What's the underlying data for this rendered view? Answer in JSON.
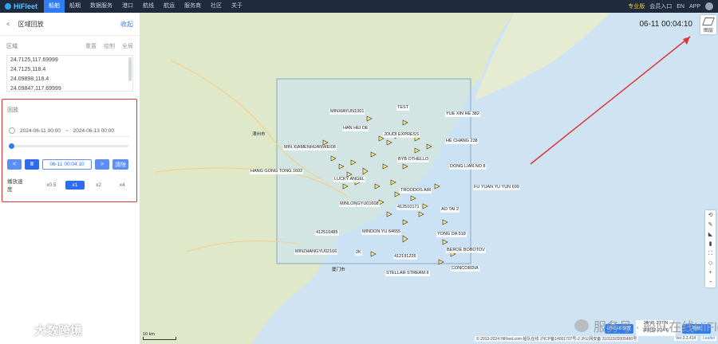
{
  "topbar": {
    "logo": "HiFleet",
    "nav": [
      "船舶",
      "船期",
      "数据服务",
      "港口",
      "航线",
      "航运",
      "服务商",
      "社区",
      "关于"
    ],
    "active_index": 0,
    "right": [
      "专业版",
      "会员入口",
      "EN",
      "APP"
    ]
  },
  "panel": {
    "back": "<",
    "title": "区域回放",
    "collapse": "收起",
    "area_label": "区域",
    "area_actions": [
      "重置",
      "绘制",
      "全局"
    ],
    "coords": [
      "24.7125,117.69999",
      "24.7125,118.4",
      "24.09898,118.4",
      "24.09847,117.69999"
    ],
    "playback": {
      "title": "回放",
      "start": "2024-06-11 00:00",
      "sep": "~",
      "end": "2024-06-13 00:00",
      "btn_prev": "<",
      "btn_pause": "II",
      "time": "06-11 00:04:10",
      "btn_next": ">",
      "btn_stop": "清除",
      "speed_label": "播放速度",
      "speeds": [
        "x0.5",
        "x1",
        "x2",
        "x4"
      ],
      "speed_active": 1
    }
  },
  "map": {
    "clock": "06-11 00:04:10",
    "layer_label": "图层",
    "vessel_labels": [
      "MINXIAYUN1001",
      "TEST",
      "HAN HEI DE",
      "YUE XIN HE 382",
      "JOUDI EXPRESS",
      "HE CHANG 238",
      "MIN XIAMENHUANWEI08",
      "BYB OTHELLO",
      "DONG LIAN NO 8",
      "HANG GONG TONG 1602",
      "LUCKY ANGEL",
      "TROODOS AIR",
      "FU YUAN YU YUN 699",
      "MINLONGYU01608",
      "412510171",
      "AO TAI 2",
      "412510485",
      "MINDON YU 64655",
      "YONG DA 518",
      "MINZHANGYU02166",
      "2K",
      "412191226",
      "BEROE BOBOTOV",
      "CONCORDIA",
      "STELLAR STREAM II"
    ],
    "places": [
      "漳州市",
      "厦门市"
    ],
    "toolbar": [
      "⟲",
      "✎",
      "◣",
      "▮",
      "⛶",
      "◇",
      "+",
      "−"
    ],
    "scale": "10 km",
    "utc_btn": "UTC+8 设置",
    "coord_lines": [
      "24°41.317 N",
      "118°52.224 E"
    ],
    "nav_btn": "导航",
    "copyright": "© 2013-2024 HiFleet.com 船队在线 沪ICP备14001707号-2 沪公网安备 31011502005490号",
    "version": "Ver.3.3.414",
    "leaflet": "Leaflet"
  },
  "watermarks": {
    "service": "服务号 · 船队在线HiFleet",
    "bottom": "大数跨境"
  },
  "colors": {
    "accent": "#2d7df6",
    "highlight": "#e03535",
    "vessel": "#f2e37a"
  }
}
